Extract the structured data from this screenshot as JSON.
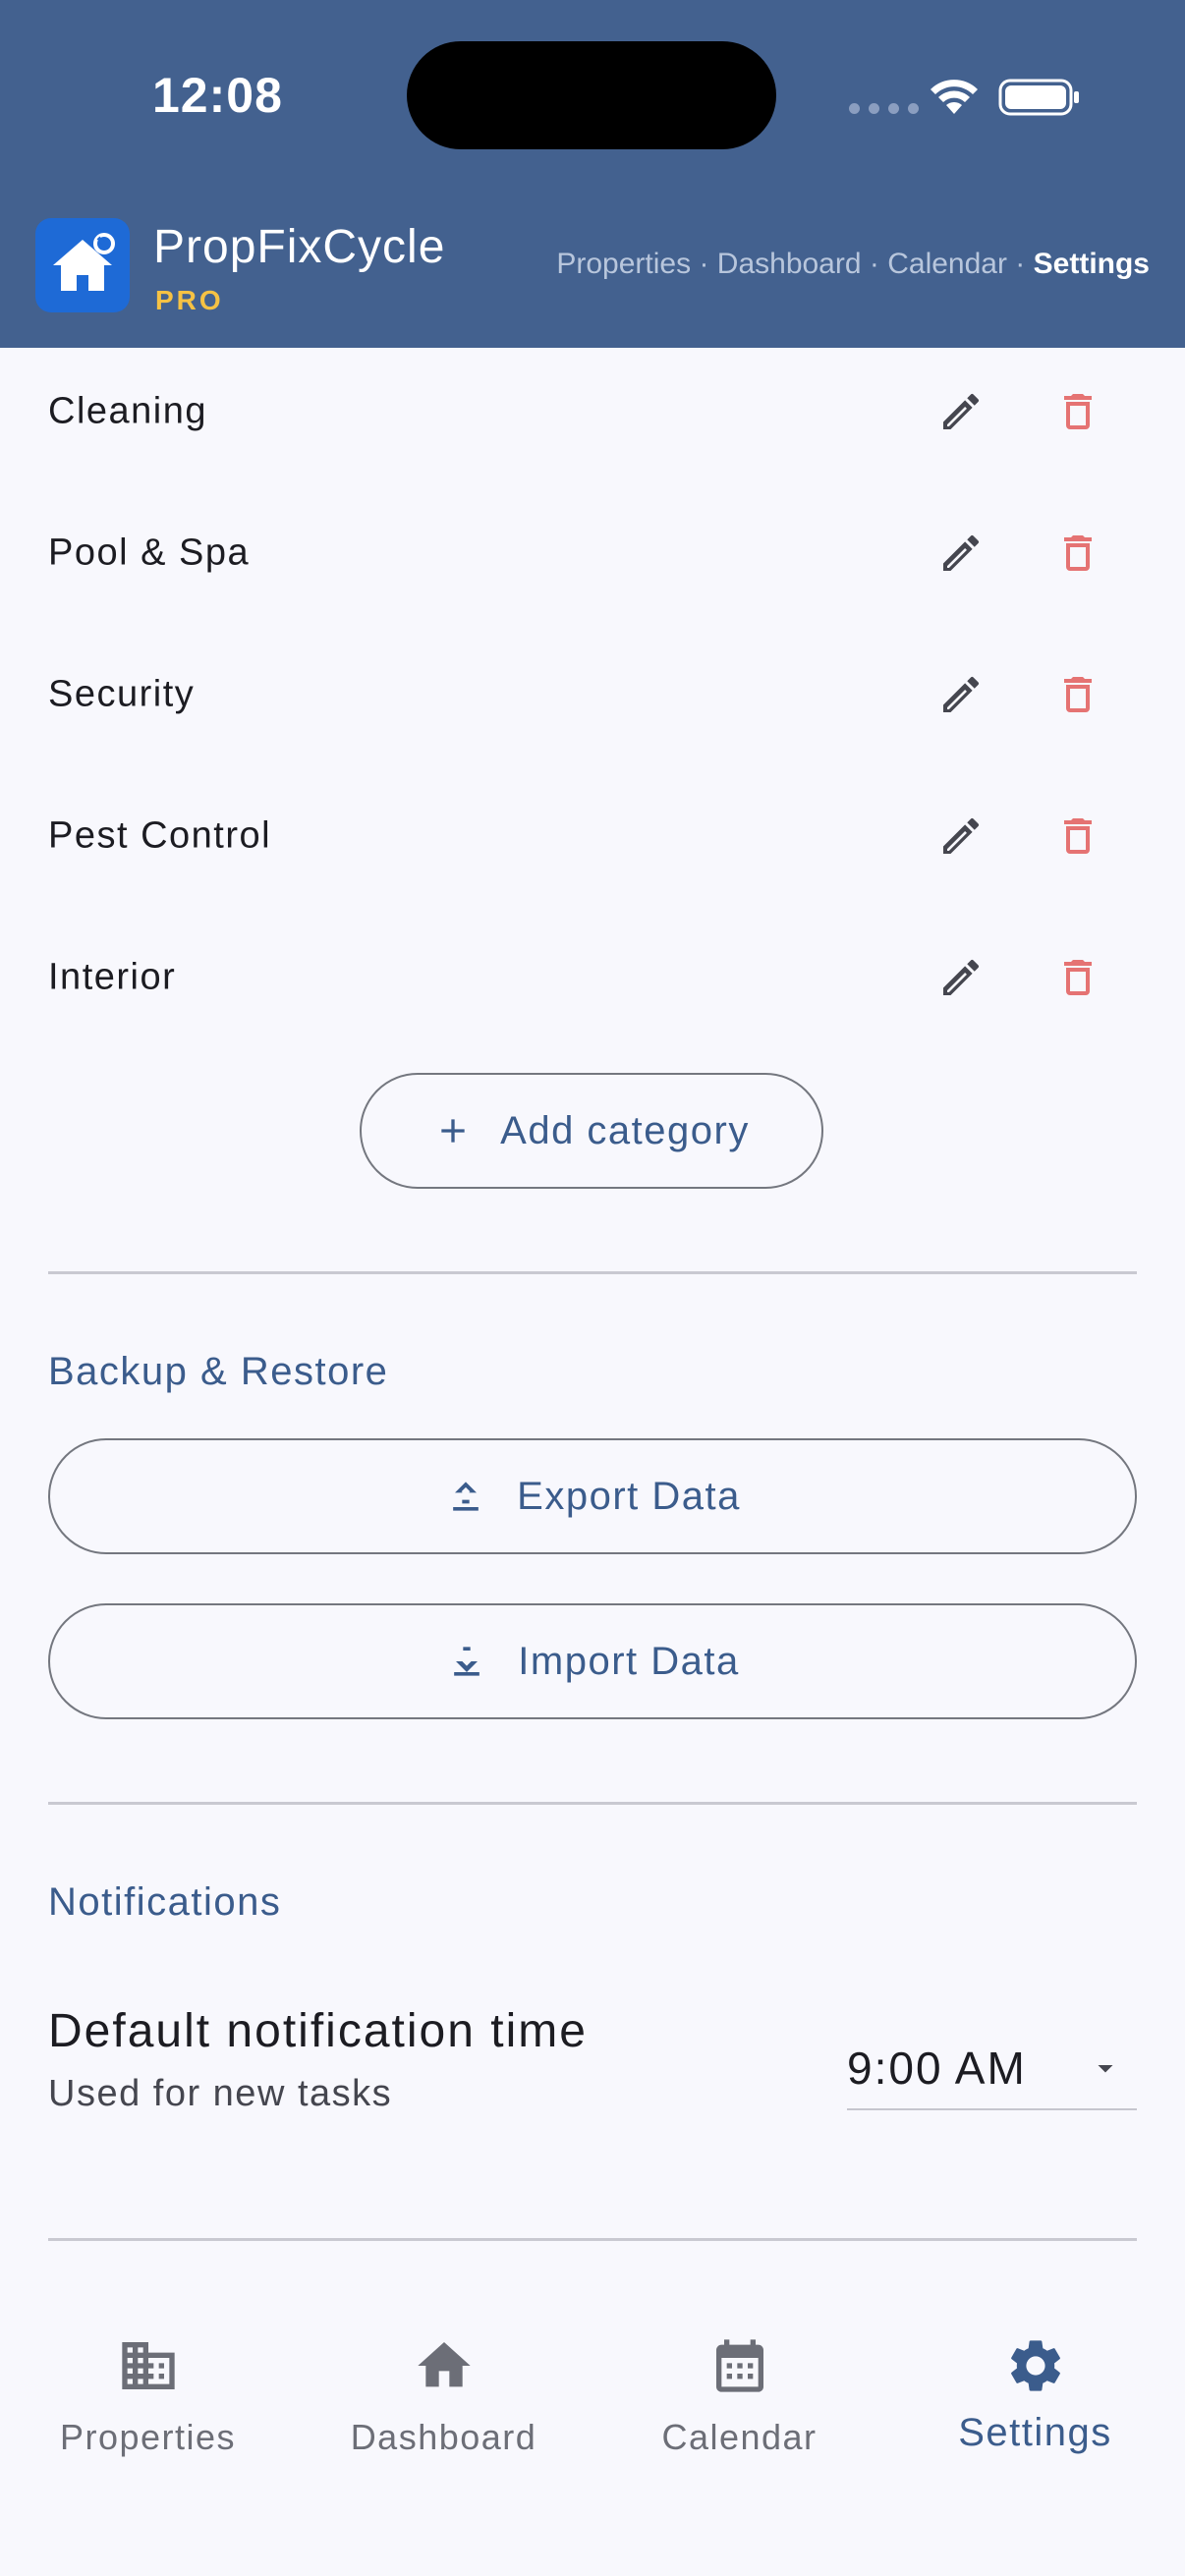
{
  "status_bar": {
    "time": "12:08"
  },
  "header": {
    "app_name": "PropFixCycle",
    "badge": "PRO",
    "nav": {
      "properties": "Properties",
      "dashboard": "Dashboard",
      "calendar": "Calendar",
      "settings": "Settings",
      "separator": " · "
    }
  },
  "categories": [
    {
      "label": "Cleaning"
    },
    {
      "label": "Pool & Spa"
    },
    {
      "label": "Security"
    },
    {
      "label": "Pest Control"
    },
    {
      "label": "Interior"
    }
  ],
  "add_category_label": "Add category",
  "backup": {
    "title": "Backup & Restore",
    "export_label": "Export Data",
    "import_label": "Import Data"
  },
  "notifications": {
    "title": "Notifications",
    "default_time_label": "Default notification time",
    "default_time_sub": "Used for new tasks",
    "default_time_value": "9:00 AM"
  },
  "bottom_nav": [
    {
      "label": "Properties",
      "icon": "building-icon",
      "active": false
    },
    {
      "label": "Dashboard",
      "icon": "home-icon",
      "active": false
    },
    {
      "label": "Calendar",
      "icon": "calendar-icon",
      "active": false
    },
    {
      "label": "Settings",
      "icon": "gear-icon",
      "active": true
    }
  ],
  "colors": {
    "header_bg": "#43618f",
    "accent": "#3b5c8c",
    "delete": "#e57373",
    "badge": "#f6c244"
  }
}
